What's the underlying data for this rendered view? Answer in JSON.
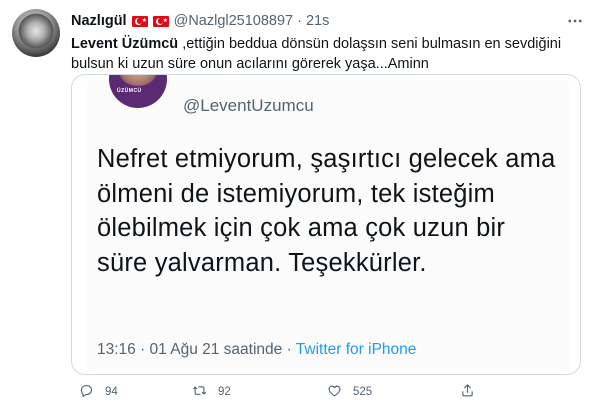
{
  "tweet": {
    "author": {
      "name": "Nazlıgül",
      "handle": "@Nazlgl25108897",
      "time": "21s",
      "flags": [
        "turkey-flag",
        "turkey-flag"
      ]
    },
    "text": {
      "mention": "Levent Üzümcü",
      "body": " ,ettiğin beddua dönsün dolaşsın seni bulmasın en sevdiğini bulsun ki uzun süre onun acılarını görerek yaşa...Aminn"
    },
    "media": {
      "handle": "@LeventUzumcu",
      "quote": "Nefret etmiyorum, şaşırtıcı gelecek ama ölmeni de istemiyorum, tek isteğim ölebilmek için çok ama çok uzun bir süre yalvarman. Teşekkürler.",
      "timestamp": "13:16 · 01 Ağu 21 saatinde · ",
      "source": "Twitter for iPhone"
    },
    "actions": {
      "reply_count": "94",
      "retweet_count": "92",
      "like_count": "525"
    }
  },
  "icons": {
    "more": "more-icon",
    "reply": "reply-icon",
    "retweet": "retweet-icon",
    "like": "heart-icon",
    "share": "share-icon"
  },
  "colors": {
    "link": "#1d9bf0",
    "secondary": "#536471",
    "border": "#cfd9de",
    "flag": "#e30a17"
  }
}
